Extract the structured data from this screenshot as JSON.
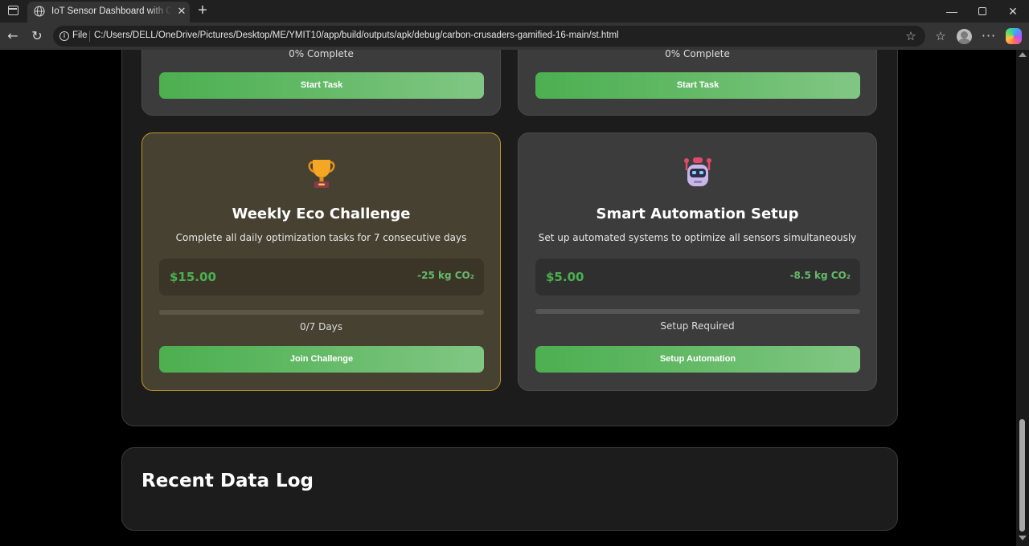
{
  "browser": {
    "tab_title": "IoT Sensor Dashboard with Carbon Crusaders",
    "file_label": "File",
    "url": "C:/Users/DELL/OneDrive/Pictures/Desktop/ME/YMIT10/app/build/outputs/apk/debug/carbon-crusaders-gamified-16-main/st.html",
    "icons": [
      "globe-icon",
      "close-icon",
      "plus-icon",
      "back-icon",
      "reload-icon",
      "info-icon",
      "star-icon",
      "favorites-icon",
      "profile-icon",
      "more-icon",
      "copilot-icon"
    ]
  },
  "tasks_top": [
    {
      "progress_text": "0% Complete",
      "progress": 0,
      "button_label": "Start Task"
    },
    {
      "progress_text": "0% Complete",
      "progress": 0,
      "button_label": "Start Task"
    }
  ],
  "challenge": {
    "icon": "trophy-icon",
    "title": "Weekly Eco Challenge",
    "description": "Complete all daily optimization tasks for 7 consecutive days",
    "reward_money": "$15.00",
    "reward_co2": "-25 kg CO₂",
    "progress": 0,
    "progress_text": "0/7 Days",
    "button_label": "Join Challenge",
    "accent_color": "#c09a25"
  },
  "automation": {
    "icon": "robot-icon",
    "title": "Smart Automation Setup",
    "description": "Set up automated systems to optimize all sensors simultaneously",
    "reward_money": "$5.00",
    "reward_co2": "-8.5 kg CO₂",
    "progress": 0,
    "progress_text": "Setup Required",
    "button_label": "Setup Automation"
  },
  "data_log": {
    "title": "Recent Data Log"
  },
  "colors": {
    "accent_green": "#4CAF50",
    "button_gradient_end": "#81C784",
    "card_bg": "#3c3c3c",
    "section_bg": "#1c1c1c"
  }
}
